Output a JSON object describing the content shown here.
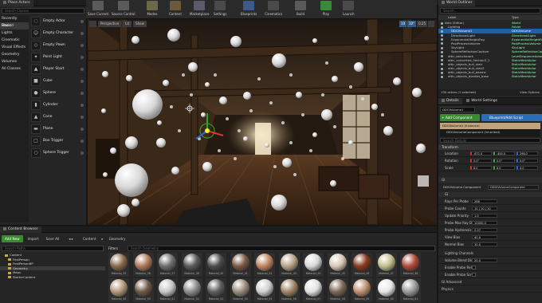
{
  "place_actors": {
    "tab_title": "Place Actors",
    "search_placeholder": "Search Classes",
    "categories": [
      "Recently Placed",
      "Basic",
      "Lights",
      "Cinematic",
      "Visual Effects",
      "Geometry",
      "Volumes",
      "All Classes"
    ],
    "selected_category": 1,
    "actors": [
      "Empty Actor",
      "Empty Character",
      "Empty Pawn",
      "Point Light",
      "Player Start",
      "Cube",
      "Sphere",
      "Cylinder",
      "Cone",
      "Plane",
      "Box Trigger",
      "Sphere Trigger"
    ]
  },
  "toolbar": {
    "buttons": [
      "Save Current",
      "Source Control",
      "Modes",
      "Content",
      "Marketplace",
      "Settings",
      "Blueprints",
      "Cinematics",
      "Build",
      "Play",
      "Launch"
    ]
  },
  "viewport": {
    "view_label": "Perspective",
    "lit_label": "Lit",
    "show_label": "Show",
    "snap_value": "10",
    "angle_value": "10°",
    "scale_value": "0.25"
  },
  "world_outliner": {
    "tab_title": "World Outliner",
    "search_placeholder": "Search...",
    "col_label": "Label",
    "col_type": "Type",
    "rows": [
      {
        "label": "Attic (Editor)",
        "type": "World",
        "indent": 0
      },
      {
        "label": "Lighting",
        "type": "Folder",
        "indent": 1
      },
      {
        "label": "DDGIVolume1",
        "type": "DDGIVolume",
        "indent": 2,
        "selected": true
      },
      {
        "label": "DirectionalLight",
        "type": "DirectionalLight",
        "indent": 2
      },
      {
        "label": "ExponentialHeightFog",
        "type": "ExponentialHeightFog",
        "indent": 2
      },
      {
        "label": "PostProcessVolume",
        "type": "PostProcessVolume",
        "indent": 2
      },
      {
        "label": "SkyLight",
        "type": "SkyLight",
        "indent": 2
      },
      {
        "label": "SphereReflectionCapture",
        "type": "SphereReflectionCapture",
        "indent": 2
      },
      {
        "label": "attic_benchmark",
        "type": "LevelSequenceActor",
        "indent": 1
      },
      {
        "label": "attic_converted_Section3_1",
        "type": "StaticMeshActor",
        "indent": 1
      },
      {
        "label": "attic_objects_bull_stair",
        "type": "StaticMeshActor",
        "indent": 1
      },
      {
        "label": "attic_objects_bull_stair2",
        "type": "StaticMeshActor",
        "indent": 1
      },
      {
        "label": "attic_objects_bull_beams",
        "type": "StaticMeshActor",
        "indent": 1
      },
      {
        "label": "attic_objects_blanket_base",
        "type": "StaticMeshActor",
        "indent": 1
      }
    ],
    "status": "130 actors (1 selected)",
    "view_options": "View Options"
  },
  "details": {
    "tab_title": "Details",
    "tab_world_settings": "World Settings",
    "actor_name": "DDGIVolume1",
    "add_component": "+ Add Component",
    "blueprint_script": "Blueprint/Add Script",
    "component_root": "DDGIVolume1 (Instance)",
    "component_child": "DDGIVolumeComponent (Inherited)",
    "search_placeholder": "Search Details",
    "transform_label": "Transform",
    "location_label": "Location",
    "rotation_label": "Rotation",
    "scale_label": "Scale",
    "location": [
      "-672.0",
      "-400.0",
      "298.0"
    ],
    "rotation": [
      "0.0°",
      "0.0°",
      "0.0°"
    ],
    "scale": [
      "8.0",
      "8.0",
      "4.0"
    ],
    "gi_label": "GI",
    "component_section": "DDGIVolume Component",
    "component_dropdown": "DDGIVolumeComponent",
    "settings_label": "GI",
    "props": [
      {
        "name": "Rays Per Probe",
        "value": "288"
      },
      {
        "name": "Probe Counts",
        "value": "10 | 10 | 10"
      },
      {
        "name": "Update Priority",
        "value": "1.0"
      },
      {
        "name": "Probe Max Ray Dist",
        "value": "10000.0"
      },
      {
        "name": "Probe Hysteresis",
        "value": "0.97"
      },
      {
        "name": "View Bias",
        "value": "40.0"
      },
      {
        "name": "Normal Bias",
        "value": "10.0"
      }
    ],
    "lighting_channels": "Lighting Channels",
    "volume_blend_dist": "Volume Blend Dist",
    "volume_blend_value": "20.0",
    "enable_probe_relocation": "Enable Probe Rel",
    "enable_probe_scrolling": "Enable Probe Scr",
    "gi_advanced": "GI Advanced",
    "physics": "Physics"
  },
  "content_browser": {
    "tab_title": "Content Browser",
    "add_new": "Add New",
    "import": "Import",
    "save_all": "Save All",
    "path": [
      "Content",
      "Geometry"
    ],
    "filters": "Filters",
    "search_paths_placeholder": "Search Paths",
    "search_geometry_placeholder": "Search Geometry",
    "folders": [
      "Content",
      "FirstPerson",
      "FirstPersonBP",
      "Geometry",
      "Maps",
      "StarterContent"
    ],
    "selected_folder": 3,
    "thumbnails_row1": [
      "Material_35",
      "Material_36",
      "Material_37",
      "Material_38",
      "Material_40",
      "Material_41",
      "Material_42",
      "Material_43",
      "Material_44",
      "Material_45",
      "Material_46",
      "Material_47",
      "Material_48"
    ],
    "thumbnails_row2": [
      "Material_49",
      "Material_50",
      "Material_51",
      "Material_52",
      "Material_53",
      "Material_54",
      "Material_55",
      "Material_56",
      "Material_57",
      "Material_58",
      "Material_59",
      "Material_60",
      "Material_61"
    ],
    "colors_row1": [
      "#8a6a4c",
      "#b07a5a",
      "#6e6e6e",
      "#5a5a5a",
      "#4c4c4c",
      "#7a5a45",
      "#c28760",
      "#b8a588",
      "#d8d8d8",
      "#d9c9b5",
      "#8a3b20",
      "#c4bf8c",
      "#b04a3a"
    ],
    "colors_row2": [
      "#b39a7c",
      "#6f5a48",
      "#c7c7c7",
      "#8c8c8c",
      "#5f5f5f",
      "#9c8c7c",
      "#d0d0d0",
      "#a28468",
      "#e0e0e0",
      "#7d6a58",
      "#c09070",
      "#e8e8e8",
      "#9a9a9a"
    ]
  }
}
